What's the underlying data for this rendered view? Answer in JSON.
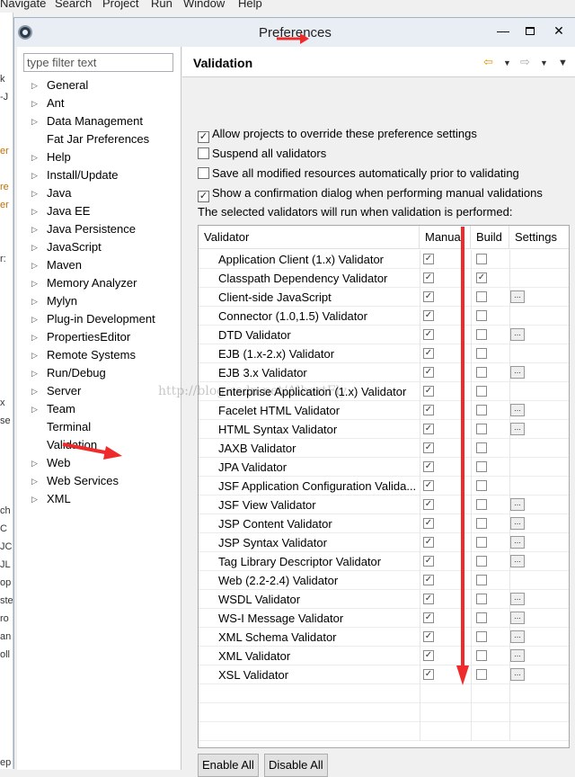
{
  "menubar": [
    "Navigate",
    "Search",
    "Project",
    "Run",
    "Window",
    "Help"
  ],
  "background_left_fragments": [
    "k",
    "-J",
    "er",
    "re",
    "er",
    "r:",
    "x",
    "se",
    "ch",
    "C",
    "JC",
    "JL",
    "op",
    "ste",
    "ro",
    "an",
    "oll",
    "ep"
  ],
  "dialog": {
    "title": "Preferences",
    "min_label": "—",
    "close_label": "✕"
  },
  "filter": {
    "placeholder": "type filter text"
  },
  "tree": [
    {
      "label": "General",
      "expandable": true
    },
    {
      "label": "Ant",
      "expandable": true
    },
    {
      "label": "Data Management",
      "expandable": true
    },
    {
      "label": "Fat Jar Preferences",
      "expandable": false
    },
    {
      "label": "Help",
      "expandable": true
    },
    {
      "label": "Install/Update",
      "expandable": true
    },
    {
      "label": "Java",
      "expandable": true
    },
    {
      "label": "Java EE",
      "expandable": true
    },
    {
      "label": "Java Persistence",
      "expandable": true
    },
    {
      "label": "JavaScript",
      "expandable": true
    },
    {
      "label": "Maven",
      "expandable": true
    },
    {
      "label": "Memory Analyzer",
      "expandable": true
    },
    {
      "label": "Mylyn",
      "expandable": true
    },
    {
      "label": "Plug-in Development",
      "expandable": true
    },
    {
      "label": "PropertiesEditor",
      "expandable": true
    },
    {
      "label": "Remote Systems",
      "expandable": true
    },
    {
      "label": "Run/Debug",
      "expandable": true
    },
    {
      "label": "Server",
      "expandable": true
    },
    {
      "label": "Team",
      "expandable": true
    },
    {
      "label": "Terminal",
      "expandable": false
    },
    {
      "label": "Validation",
      "expandable": false,
      "selected": true
    },
    {
      "label": "Web",
      "expandable": true
    },
    {
      "label": "Web Services",
      "expandable": true
    },
    {
      "label": "XML",
      "expandable": true
    }
  ],
  "page": {
    "title": "Validation",
    "options": [
      {
        "label": "Allow projects to override these preference settings",
        "checked": true
      },
      {
        "label": "Suspend all validators",
        "checked": false
      },
      {
        "label": "Save all modified resources automatically prior to validating",
        "checked": false
      },
      {
        "label": "Show a confirmation dialog when performing manual validations",
        "checked": true
      }
    ],
    "info": "The selected validators will run when validation is performed:"
  },
  "table": {
    "headers": {
      "validator": "Validator",
      "manual": "Manual",
      "build": "Build",
      "settings": "Settings"
    },
    "rows": [
      {
        "name": "Application Client (1.x) Validator",
        "manual": true,
        "build": false,
        "settings": false
      },
      {
        "name": "Classpath Dependency Validator",
        "manual": true,
        "build": true,
        "settings": false
      },
      {
        "name": "Client-side JavaScript",
        "manual": true,
        "build": false,
        "settings": true
      },
      {
        "name": "Connector (1.0,1.5) Validator",
        "manual": true,
        "build": false,
        "settings": false
      },
      {
        "name": "DTD Validator",
        "manual": true,
        "build": false,
        "settings": true
      },
      {
        "name": "EJB (1.x-2.x) Validator",
        "manual": true,
        "build": false,
        "settings": false
      },
      {
        "name": "EJB 3.x Validator",
        "manual": true,
        "build": false,
        "settings": true
      },
      {
        "name": "Enterprise Application (1.x) Validator",
        "manual": true,
        "build": false,
        "settings": false
      },
      {
        "name": "Facelet HTML Validator",
        "manual": true,
        "build": false,
        "settings": true
      },
      {
        "name": "HTML Syntax Validator",
        "manual": true,
        "build": false,
        "settings": true
      },
      {
        "name": "JAXB Validator",
        "manual": true,
        "build": false,
        "settings": false
      },
      {
        "name": "JPA Validator",
        "manual": true,
        "build": false,
        "settings": false
      },
      {
        "name": "JSF Application Configuration Valida...",
        "manual": true,
        "build": false,
        "settings": false
      },
      {
        "name": "JSF View Validator",
        "manual": true,
        "build": false,
        "settings": true
      },
      {
        "name": "JSP Content Validator",
        "manual": true,
        "build": false,
        "settings": true
      },
      {
        "name": "JSP Syntax Validator",
        "manual": true,
        "build": false,
        "settings": true
      },
      {
        "name": "Tag Library Descriptor Validator",
        "manual": true,
        "build": false,
        "settings": true
      },
      {
        "name": "Web (2.2-2.4) Validator",
        "manual": true,
        "build": false,
        "settings": false
      },
      {
        "name": "WSDL Validator",
        "manual": true,
        "build": false,
        "settings": true
      },
      {
        "name": "WS-I Message Validator",
        "manual": true,
        "build": false,
        "settings": true
      },
      {
        "name": "XML Schema Validator",
        "manual": true,
        "build": false,
        "settings": true
      },
      {
        "name": "XML Validator",
        "manual": true,
        "build": false,
        "settings": true
      },
      {
        "name": "XSL Validator",
        "manual": true,
        "build": false,
        "settings": true
      }
    ]
  },
  "buttons": {
    "enable_all": "Enable All",
    "disable_all": "Disable All"
  },
  "watermark": "http://blog.csdn.net/AlbertFly",
  "colors": {
    "annotation_arrow": "#ee2a2a",
    "nav_back": "#d89800"
  },
  "icons": {
    "settings_button": "...",
    "check": "✓"
  }
}
